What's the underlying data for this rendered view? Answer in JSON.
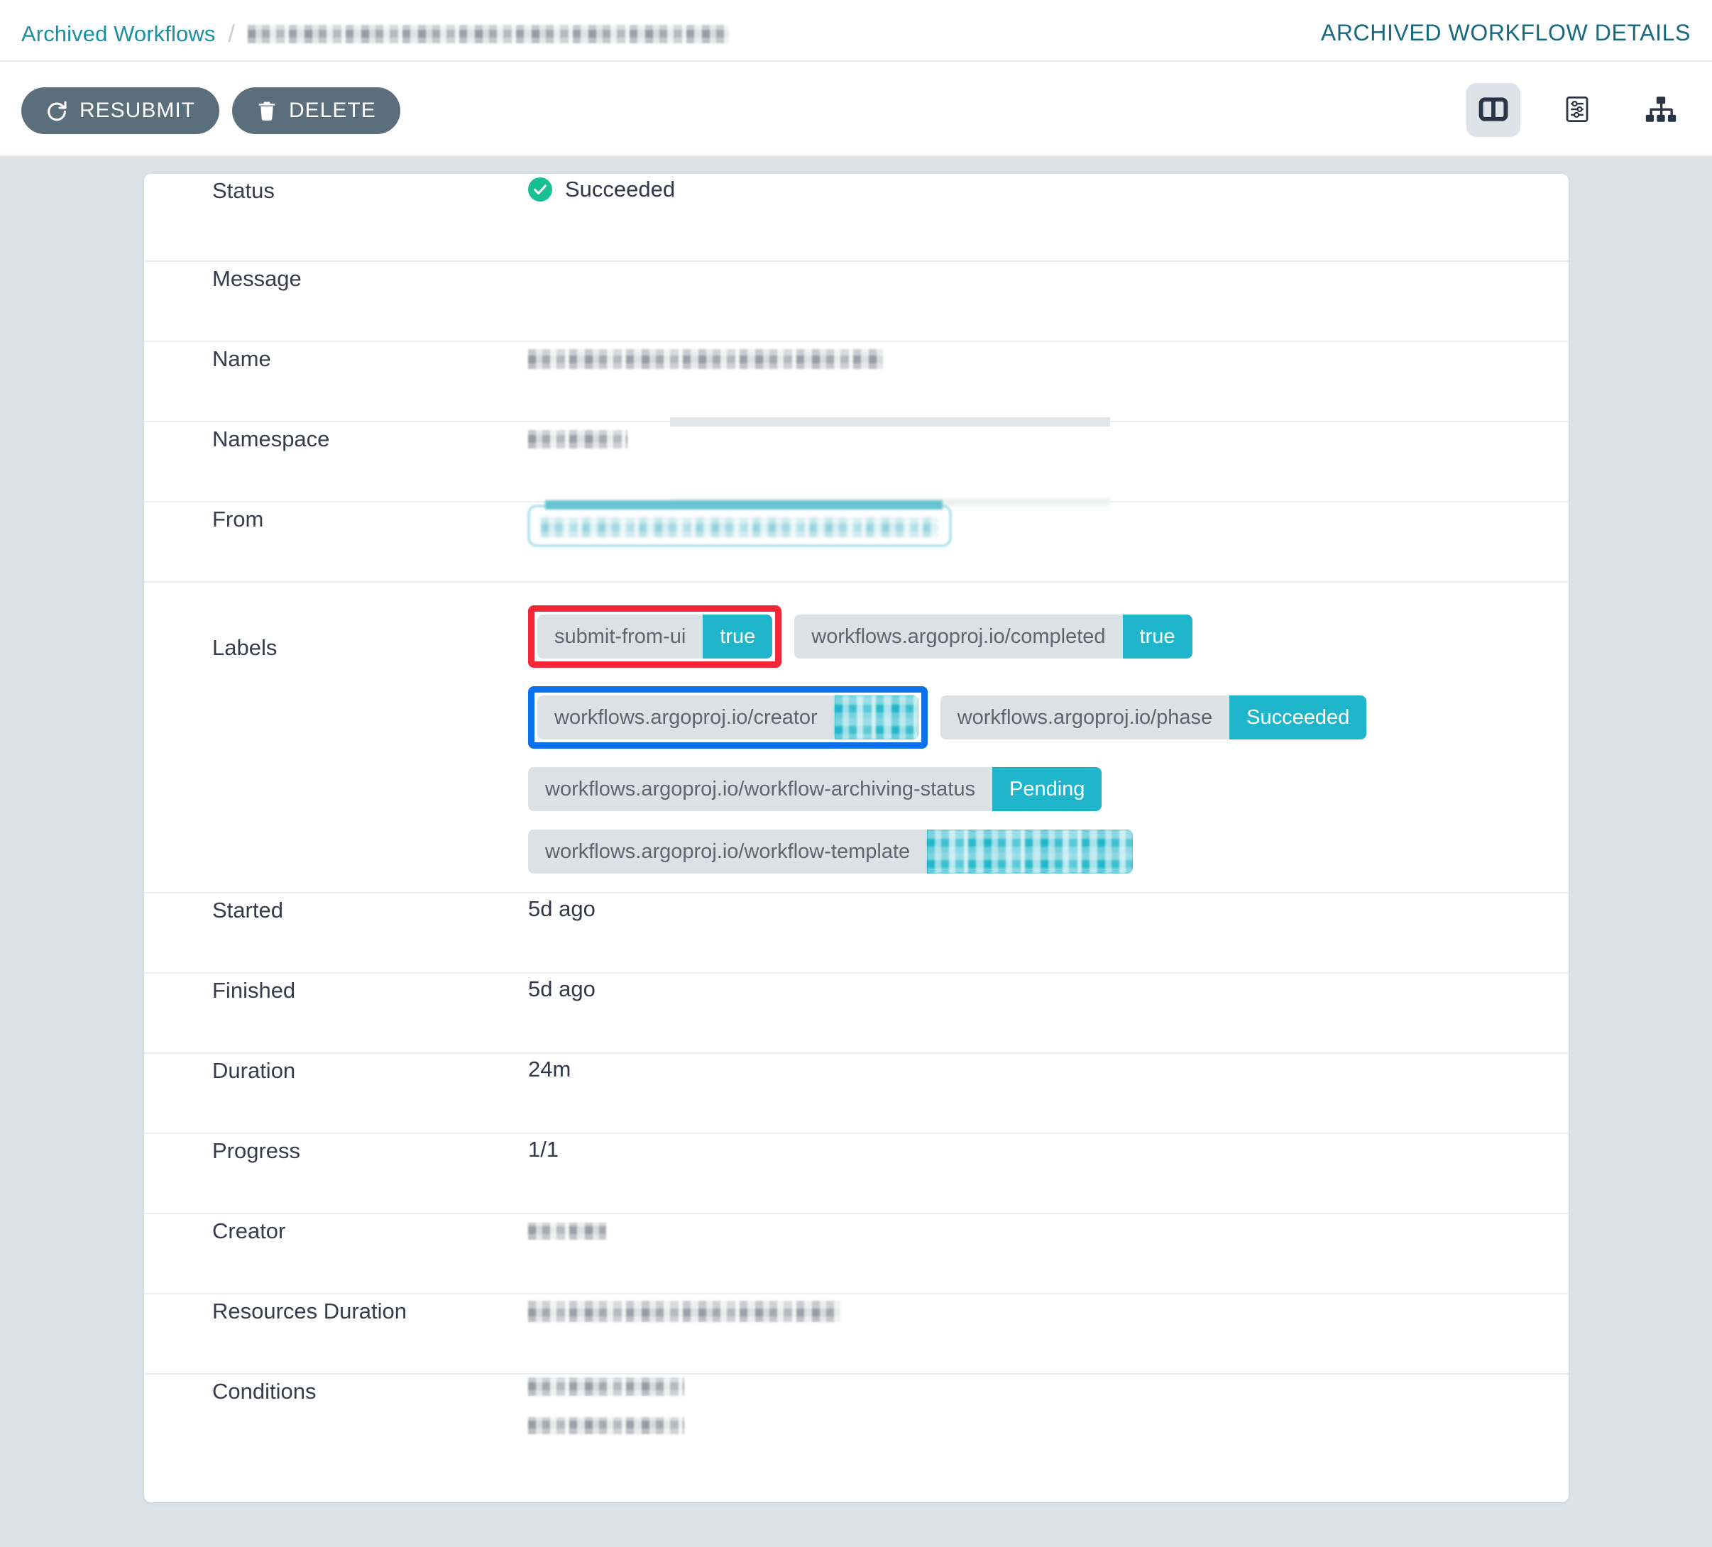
{
  "header": {
    "breadcrumb_root": "Archived Workflows",
    "breadcrumb_separator": "/",
    "breadcrumb_current": "",
    "page_title": "ARCHIVED WORKFLOW DETAILS"
  },
  "toolbar": {
    "resubmit_label": "RESUBMIT",
    "delete_label": "DELETE",
    "view_toggles": [
      {
        "name": "split-panel-view",
        "active": true
      },
      {
        "name": "workflow-yaml-view",
        "active": false
      },
      {
        "name": "workflow-graph-view",
        "active": false
      }
    ]
  },
  "details": {
    "status": {
      "label": "Status",
      "value": "Succeeded",
      "icon": "check-circle-icon",
      "color": "#18be94"
    },
    "message": {
      "label": "Message",
      "value": ""
    },
    "name": {
      "label": "Name",
      "value": ""
    },
    "namespace": {
      "label": "Namespace",
      "value": ""
    },
    "from": {
      "label": "From",
      "value": ""
    },
    "labels": {
      "label": "Labels"
    },
    "started": {
      "label": "Started",
      "value": "5d ago"
    },
    "finished": {
      "label": "Finished",
      "value": "5d ago"
    },
    "duration": {
      "label": "Duration",
      "value": "24m"
    },
    "progress": {
      "label": "Progress",
      "value": "1/1"
    },
    "creator": {
      "label": "Creator",
      "value": ""
    },
    "resources_duration": {
      "label": "Resources Duration",
      "value": ""
    },
    "conditions": {
      "label": "Conditions",
      "value": ""
    }
  },
  "labels": [
    {
      "key": "submit-from-ui",
      "value": "true",
      "value_redacted": false,
      "highlight": "red"
    },
    {
      "key": "workflows.argoproj.io/completed",
      "value": "true",
      "value_redacted": false,
      "highlight": "none"
    },
    {
      "key": "workflows.argoproj.io/creator",
      "value": "",
      "value_redacted": true,
      "highlight": "blue"
    },
    {
      "key": "workflows.argoproj.io/phase",
      "value": "Succeeded",
      "value_redacted": false,
      "highlight": "none"
    },
    {
      "key": "workflows.argoproj.io/workflow-archiving-status",
      "value": "Pending",
      "value_redacted": false,
      "highlight": "none"
    },
    {
      "key": "workflows.argoproj.io/workflow-template",
      "value": "",
      "value_redacted": true,
      "highlight": "none"
    }
  ],
  "colors": {
    "accent_teal": "#1fb6cb",
    "link_teal": "#1b8fa3",
    "title_teal": "#16697f",
    "success_green": "#18be94",
    "button_gray": "#5b6e7c",
    "page_bg": "#dce3e8",
    "highlight_red": "#f32735",
    "highlight_blue": "#0b72ec"
  }
}
